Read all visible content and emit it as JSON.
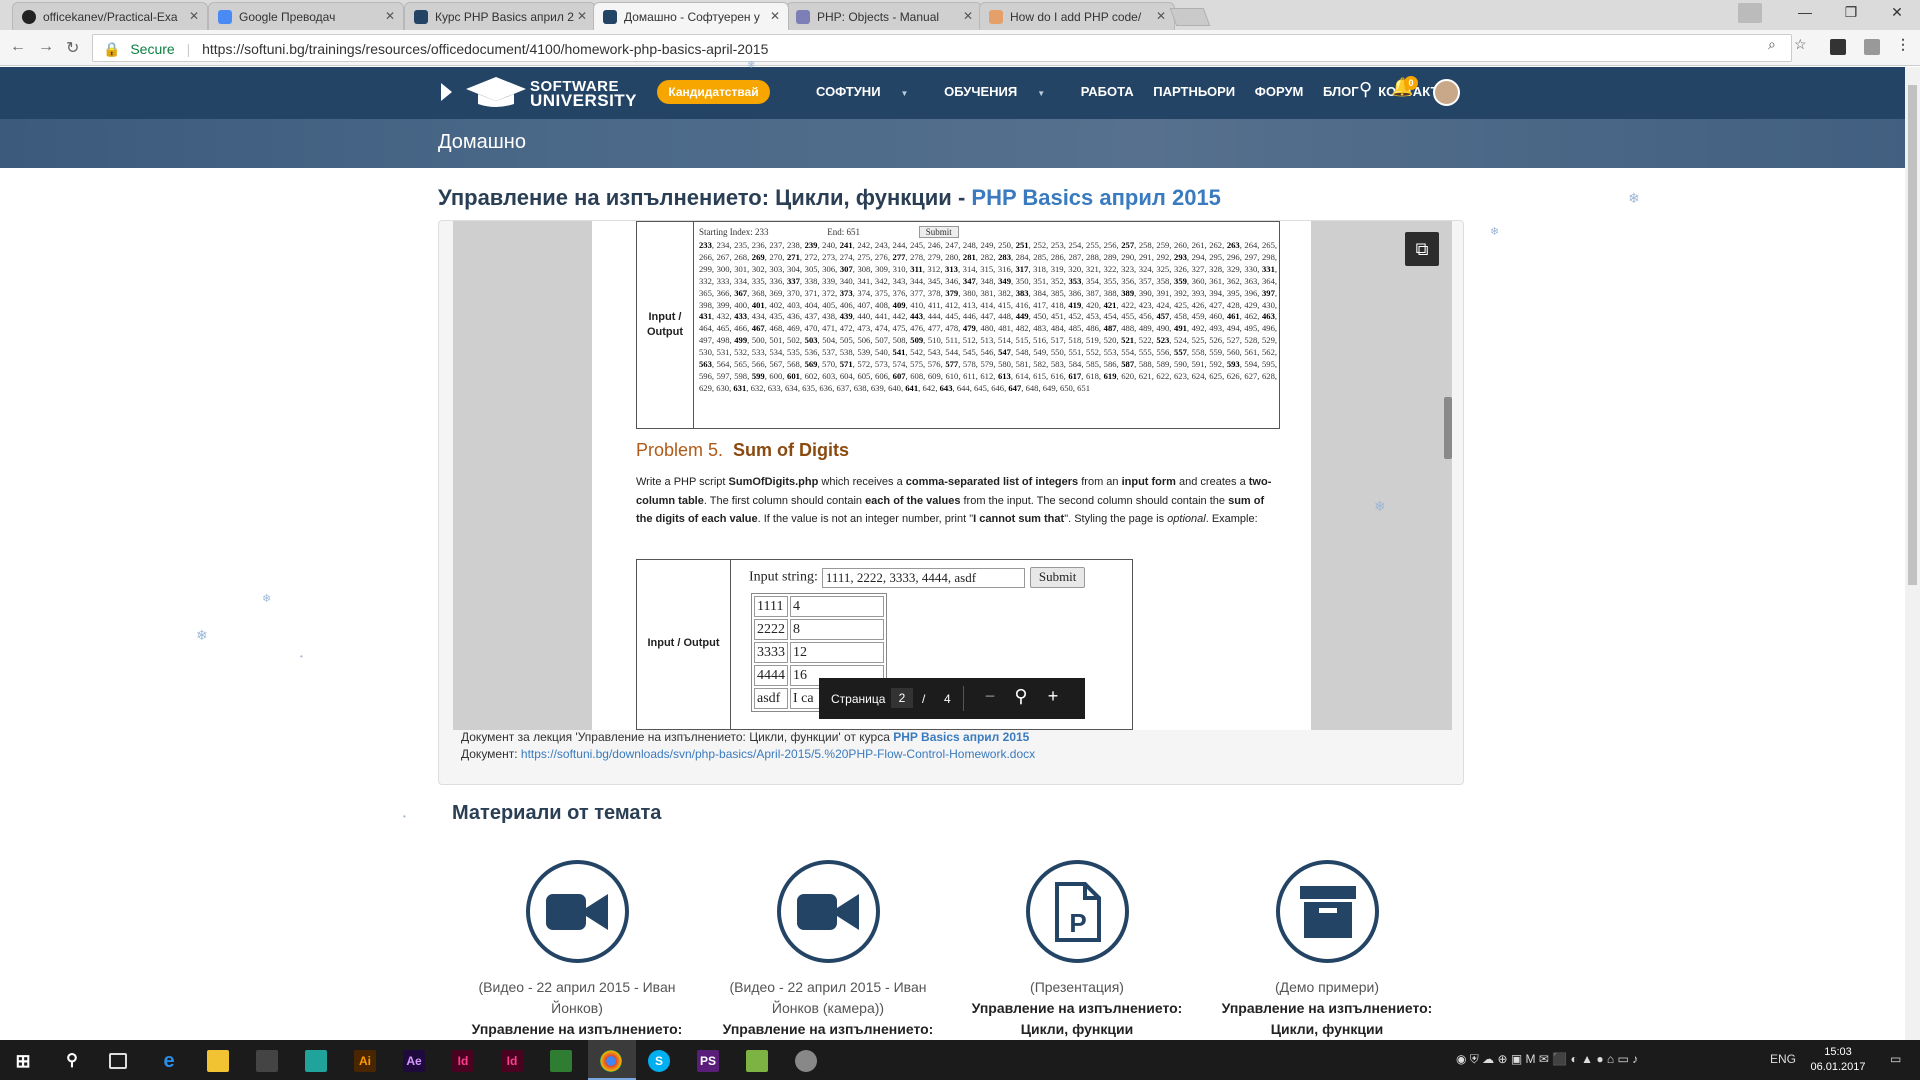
{
  "browser": {
    "tabs": [
      {
        "title": "officekanev/Practical-Exa",
        "color": "#222"
      },
      {
        "title": "Google Преводач",
        "color": "#4a8af4"
      },
      {
        "title": "Курс PHP Basics април 2",
        "color": "#234465"
      },
      {
        "title": "Домашно - Софтуерен у",
        "color": "#234465"
      },
      {
        "title": "PHP: Objects - Manual",
        "color": "#7b7fb5"
      },
      {
        "title": "How do I add PHP code/",
        "color": "#f48024"
      }
    ],
    "security_label": "Secure",
    "url": "https://softuni.bg/trainings/resources/officedocument/4100/homework-php-basics-april-2015"
  },
  "site": {
    "logo_line1": "SOFTWARE",
    "logo_line2": "UNIVERSITY",
    "apply_button": "Кандидатствай",
    "nav": [
      "СОФТУНИ",
      "ОБУЧЕНИЯ",
      "РАБОТА",
      "ПАРТНЬОРИ",
      "ФОРУМ",
      "БЛОГ",
      "КОНТАКТИ"
    ],
    "notification_count": "0",
    "banner_title": "Домашно"
  },
  "page": {
    "heading_main": "Управление на изпълнението: Цикли, функции - ",
    "heading_course": "PHP Basics април 2015"
  },
  "document": {
    "table1": {
      "label": "Input / Output",
      "start_label": "Starting Index:",
      "start_value": "233",
      "end_label": "End:",
      "end_value": "651",
      "submit": "Submit",
      "numbers_start": 233,
      "numbers_end": 651,
      "bold_numbers": [
        233,
        239,
        241,
        251,
        257,
        263,
        269,
        271,
        277,
        281,
        283,
        293,
        307,
        311,
        313,
        317,
        331,
        337,
        347,
        349,
        353,
        359,
        367,
        373,
        379,
        383,
        389,
        397,
        401,
        409,
        419,
        421,
        431,
        433,
        439,
        443,
        449,
        457,
        461,
        463,
        467,
        479,
        487,
        491,
        499,
        503,
        509,
        521,
        523,
        541,
        547,
        557,
        563,
        569,
        571,
        577,
        587,
        593,
        599,
        601,
        607,
        613,
        617,
        619,
        631,
        641,
        643,
        647
      ]
    },
    "problem_number": "Problem 5.",
    "problem_name": "Sum of Digits",
    "problem_text_html": "Write a PHP script <b>SumOfDigits.php</b> which receives a <b>comma-separated list of integers</b> from an <b>input form</b> and creates a <b>two-column table</b>. The first column should contain <b>each of the values</b> from the input. The second column should contain the <b>sum of the digits of each value</b>. If the value is not an integer number, print \"<b>I cannot sum that</b>\". Styling the page is <i>optional</i>. Example:",
    "table2": {
      "label": "Input / Output",
      "input_label": "Input string:",
      "input_value": "1111, 2222, 3333, 4444, asdf",
      "submit": "Submit",
      "rows": [
        {
          "value": "1111",
          "sum": "4"
        },
        {
          "value": "2222",
          "sum": "8"
        },
        {
          "value": "3333",
          "sum": "12"
        },
        {
          "value": "4444",
          "sum": "16"
        },
        {
          "value": "asdf",
          "sum": "I ca"
        }
      ]
    },
    "pager": {
      "label": "Страница",
      "current": "2",
      "separator": "/",
      "total": "4"
    }
  },
  "meta": {
    "line1_prefix": "Документ за лекция 'Управление на изпълнението: Цикли, функции' от курса ",
    "line1_course": "PHP Basics април 2015",
    "line2_prefix": "Документ: ",
    "line2_link": "https://softuni.bg/downloads/svn/php-basics/April-2015/5.%20PHP-Flow-Control-Homework.docx"
  },
  "materials": {
    "heading": "Материали от темата",
    "items": [
      {
        "icon": "video-camera-icon",
        "caption": "(Видео - 22 април 2015 - Иван Йонков)",
        "title": "Управление на изпълнението:"
      },
      {
        "icon": "video-camera-icon",
        "caption": "(Видео - 22 април 2015 - Иван Йонков (камера))",
        "title": "Управление на изпълнението:"
      },
      {
        "icon": "presentation-icon",
        "caption": "(Презентация)",
        "title": "Управление на изпълнението: Цикли, функции"
      },
      {
        "icon": "archive-icon",
        "caption": "(Демо примери)",
        "title": "Управление на изпълнението: Цикли, функции"
      }
    ]
  },
  "taskbar": {
    "language": "ENG",
    "time": "15:03",
    "date": "06.01.2017"
  }
}
